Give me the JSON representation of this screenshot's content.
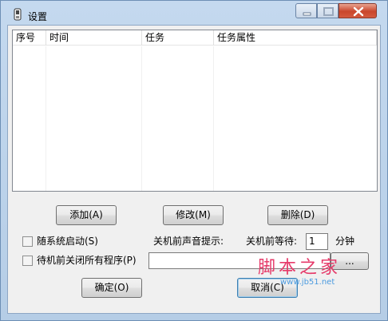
{
  "window": {
    "title": "设置"
  },
  "list": {
    "columns": [
      "序号",
      "时间",
      "任务",
      "任务属性"
    ],
    "rows": []
  },
  "buttons": {
    "add": "添加(A)",
    "modify": "修改(M)",
    "delete": "删除(D)",
    "ok": "确定(O)",
    "cancel": "取消(C)",
    "browse": "..."
  },
  "options": {
    "autostart_label": "随系统启动(S)",
    "autostart_checked": false,
    "close_programs_label": "待机前关闭所有程序(P)",
    "close_programs_checked": false,
    "sound_label": "关机前声音提示:",
    "wait_label": "关机前等待:",
    "wait_value": "1",
    "wait_unit": "分钟",
    "sound_path": ""
  },
  "watermark": {
    "brand": "脚本之家",
    "url": "www.jb51.net"
  },
  "colors": {
    "close_button": "#c9462c",
    "watermark_brand": "#e63b6a",
    "watermark_url": "#4a9adf"
  }
}
